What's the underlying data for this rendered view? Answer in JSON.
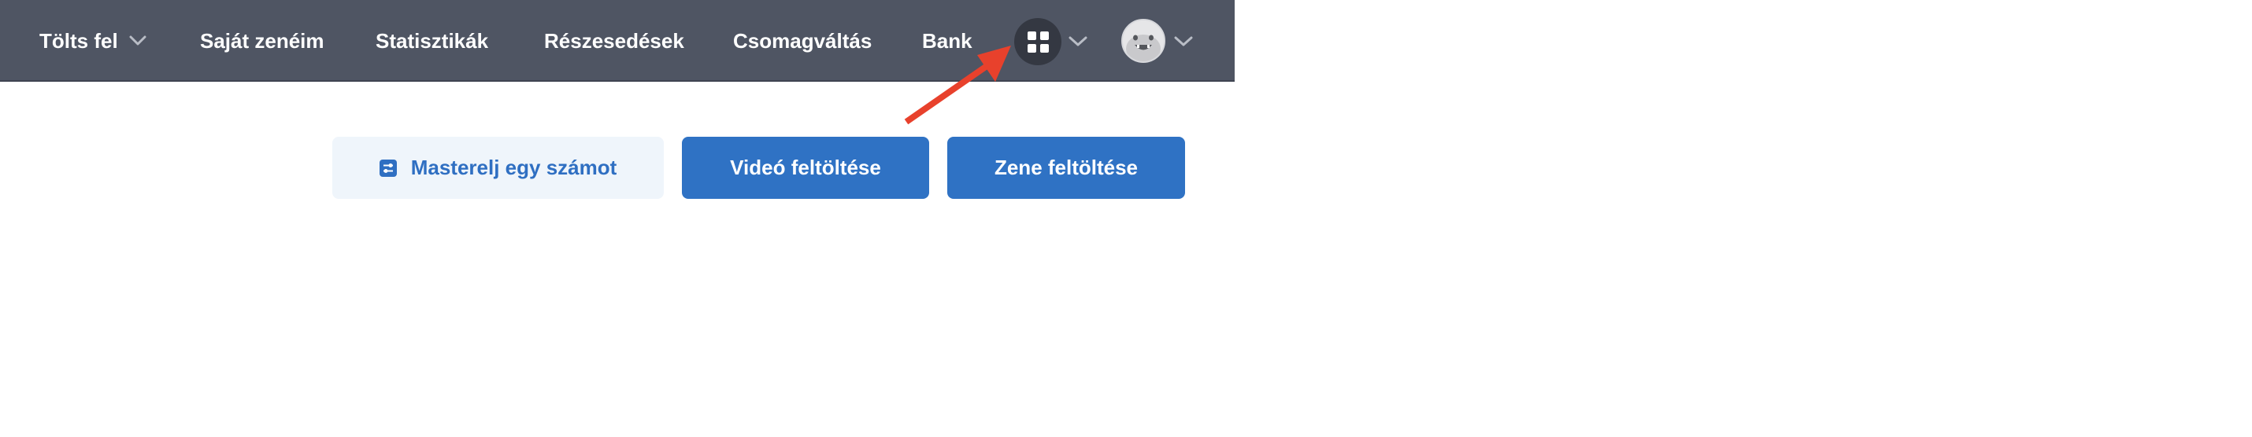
{
  "nav": {
    "upload": "Tölts fel",
    "my_music": "Saját zenéim",
    "statistics": "Statisztikák",
    "shares": "Részesedések",
    "plan_change": "Csomagváltás",
    "bank": "Bank"
  },
  "icons": {
    "apps": "grid-icon",
    "chevron": "chevron-down-icon",
    "avatar": "avatar",
    "mastering": "sliders-icon",
    "annotation": "red-arrow"
  },
  "actions": {
    "master": "Masterelj egy számot",
    "upload_video": "Videó feltöltése",
    "upload_music": "Zene feltöltése"
  },
  "colors": {
    "navbar": "#4f5563",
    "primary": "#2f72c4",
    "light_button": "#eff5fb",
    "arrow": "#e8412c"
  }
}
